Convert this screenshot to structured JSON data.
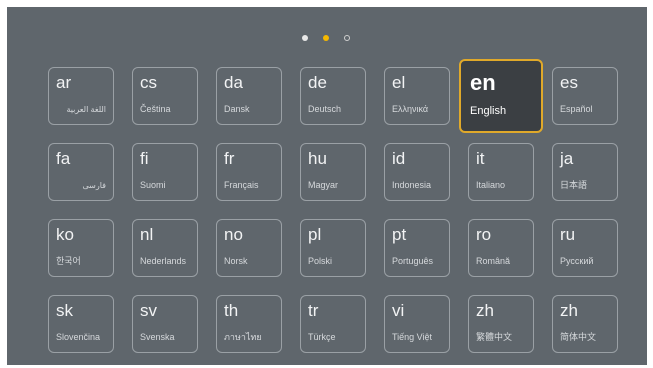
{
  "pagination": {
    "pages": [
      {
        "state": "filled"
      },
      {
        "state": "active"
      },
      {
        "state": "empty"
      }
    ],
    "current_page": 2,
    "total_pages": 3
  },
  "colors": {
    "background": "#5f666c",
    "tile_border": "#9aa0a5",
    "selected_border": "#e0a92a",
    "selected_fill": "#3b3f43",
    "active_dot": "#f5b800"
  },
  "selected_language": "en",
  "languages": [
    {
      "code": "ar",
      "name": "اللغة العربية",
      "rtl": true
    },
    {
      "code": "cs",
      "name": "Čeština"
    },
    {
      "code": "da",
      "name": "Dansk"
    },
    {
      "code": "de",
      "name": "Deutsch"
    },
    {
      "code": "el",
      "name": "Ελληνικά"
    },
    {
      "code": "en",
      "name": "English"
    },
    {
      "code": "es",
      "name": "Español"
    },
    {
      "code": "fa",
      "name": "فارسی",
      "rtl": true
    },
    {
      "code": "fi",
      "name": "Suomi"
    },
    {
      "code": "fr",
      "name": "Français"
    },
    {
      "code": "hu",
      "name": "Magyar"
    },
    {
      "code": "id",
      "name": "Indonesia"
    },
    {
      "code": "it",
      "name": "Italiano"
    },
    {
      "code": "ja",
      "name": "日本語"
    },
    {
      "code": "ko",
      "name": "한국어"
    },
    {
      "code": "nl",
      "name": "Nederlands"
    },
    {
      "code": "no",
      "name": "Norsk"
    },
    {
      "code": "pl",
      "name": "Polski"
    },
    {
      "code": "pt",
      "name": "Português"
    },
    {
      "code": "ro",
      "name": "Română"
    },
    {
      "code": "ru",
      "name": "Русский"
    },
    {
      "code": "sk",
      "name": "Slovenčina"
    },
    {
      "code": "sv",
      "name": "Svenska"
    },
    {
      "code": "th",
      "name": "ภาษาไทย"
    },
    {
      "code": "tr",
      "name": "Türkçe"
    },
    {
      "code": "vi",
      "name": "Tiếng Việt"
    },
    {
      "code": "zh",
      "name": "繁體中文"
    },
    {
      "code": "zh",
      "name": "简体中文"
    }
  ]
}
